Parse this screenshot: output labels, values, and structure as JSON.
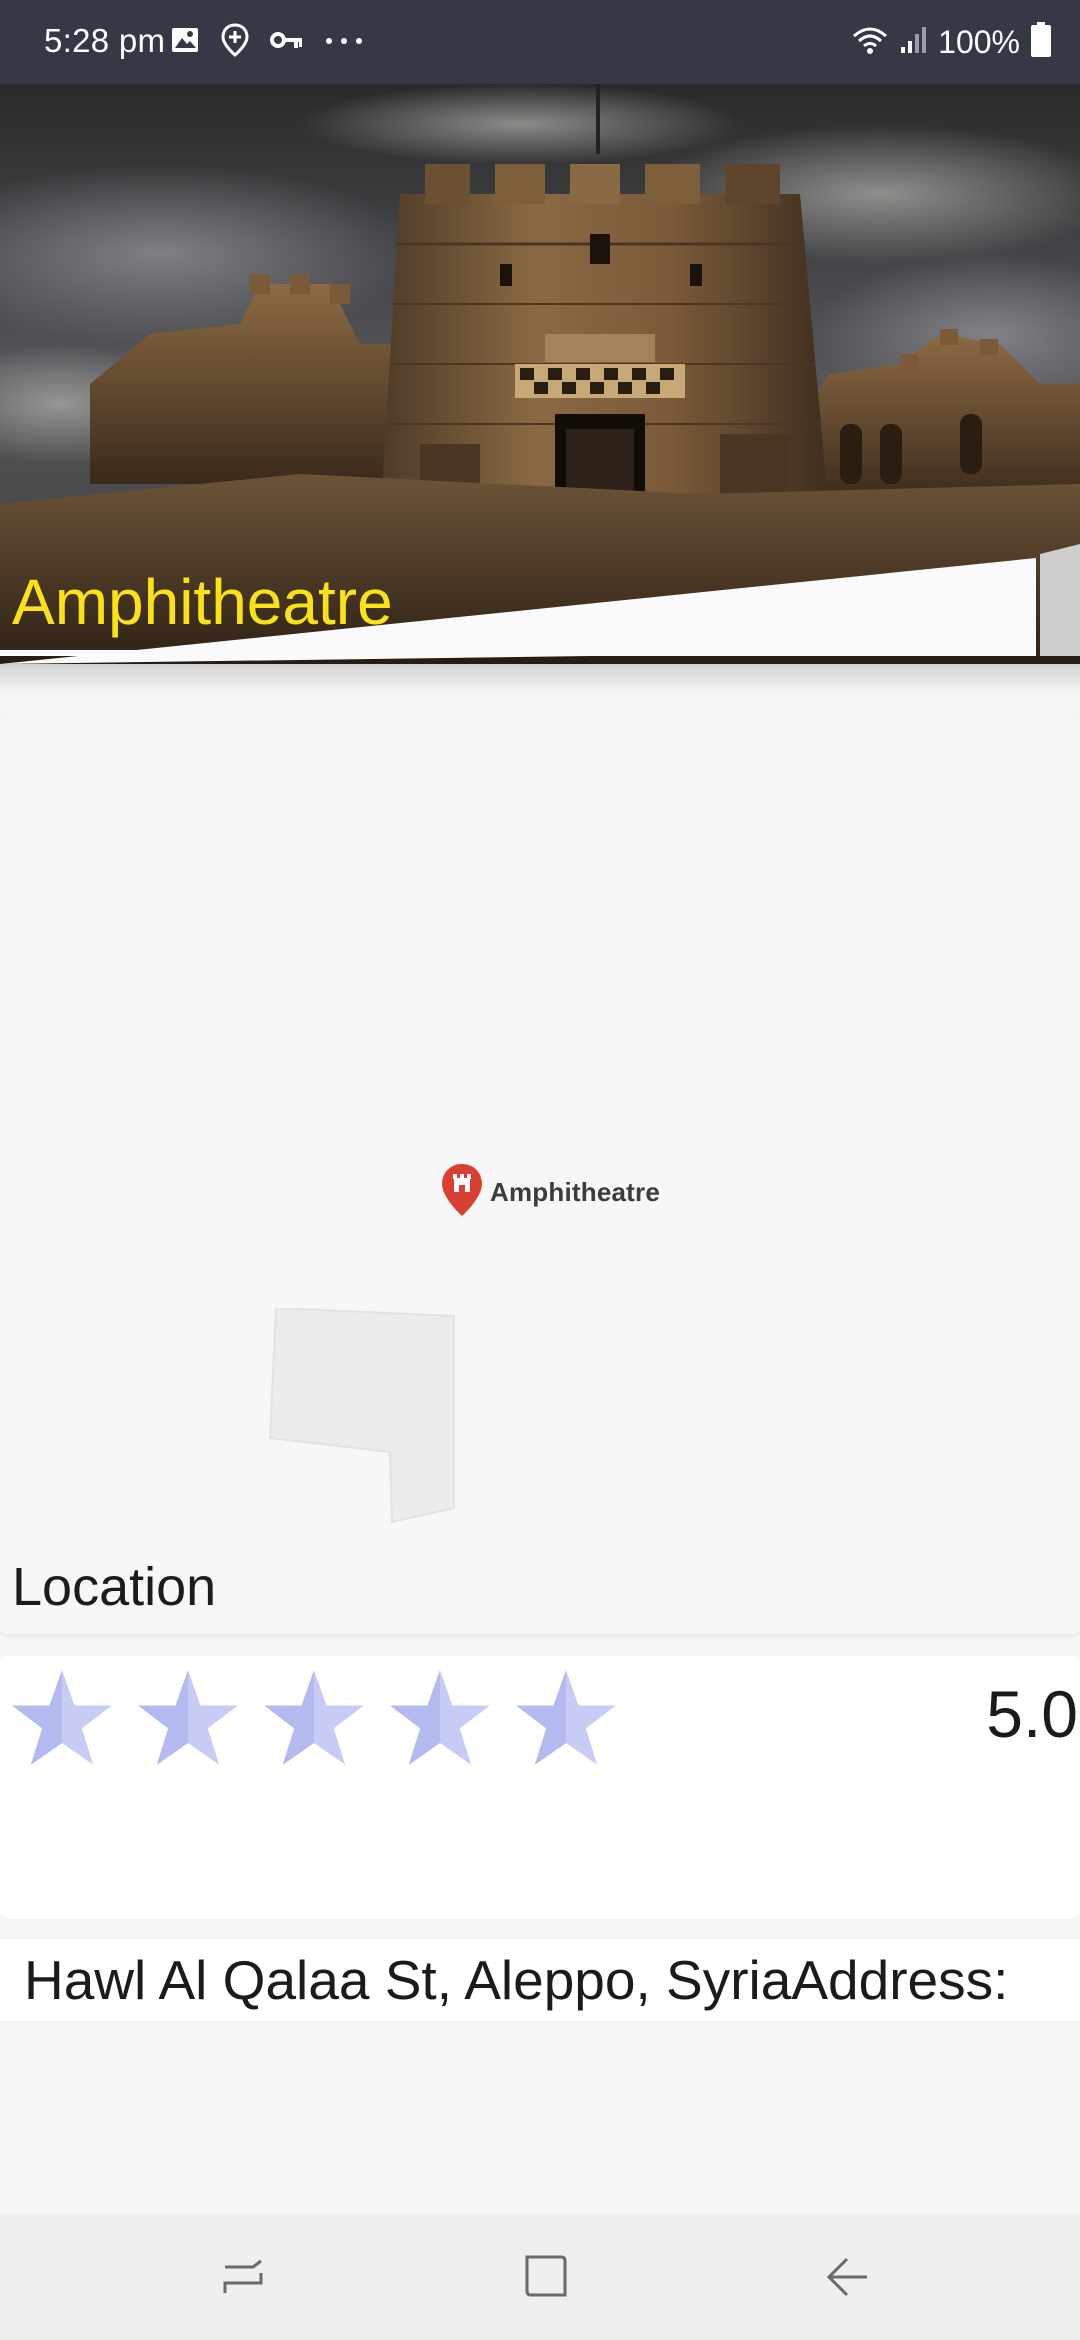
{
  "status_bar": {
    "time": "5:28 pm",
    "battery": "100%",
    "left_icons": [
      "image-icon",
      "location-plus-icon",
      "key-icon",
      "more-dots-icon"
    ],
    "right_icons": [
      "wifi-icon",
      "signal-icon",
      "battery-icon"
    ]
  },
  "hero": {
    "title": "Amphitheatre",
    "title_color": "#fbe214"
  },
  "map": {
    "marker_label": "Amphitheatre",
    "marker_icon": "castle-pin-icon",
    "marker_color": "#d94032",
    "section_label": "Location"
  },
  "rating": {
    "value": "5.0",
    "stars": 5,
    "max_stars": 5,
    "star_color": "#c8ccf5"
  },
  "address": {
    "text": "Hawl Al Qalaa St, Aleppo, SyriaAddress:"
  },
  "nav_bar": {
    "buttons": [
      "recents-icon",
      "home-icon",
      "back-icon"
    ]
  }
}
